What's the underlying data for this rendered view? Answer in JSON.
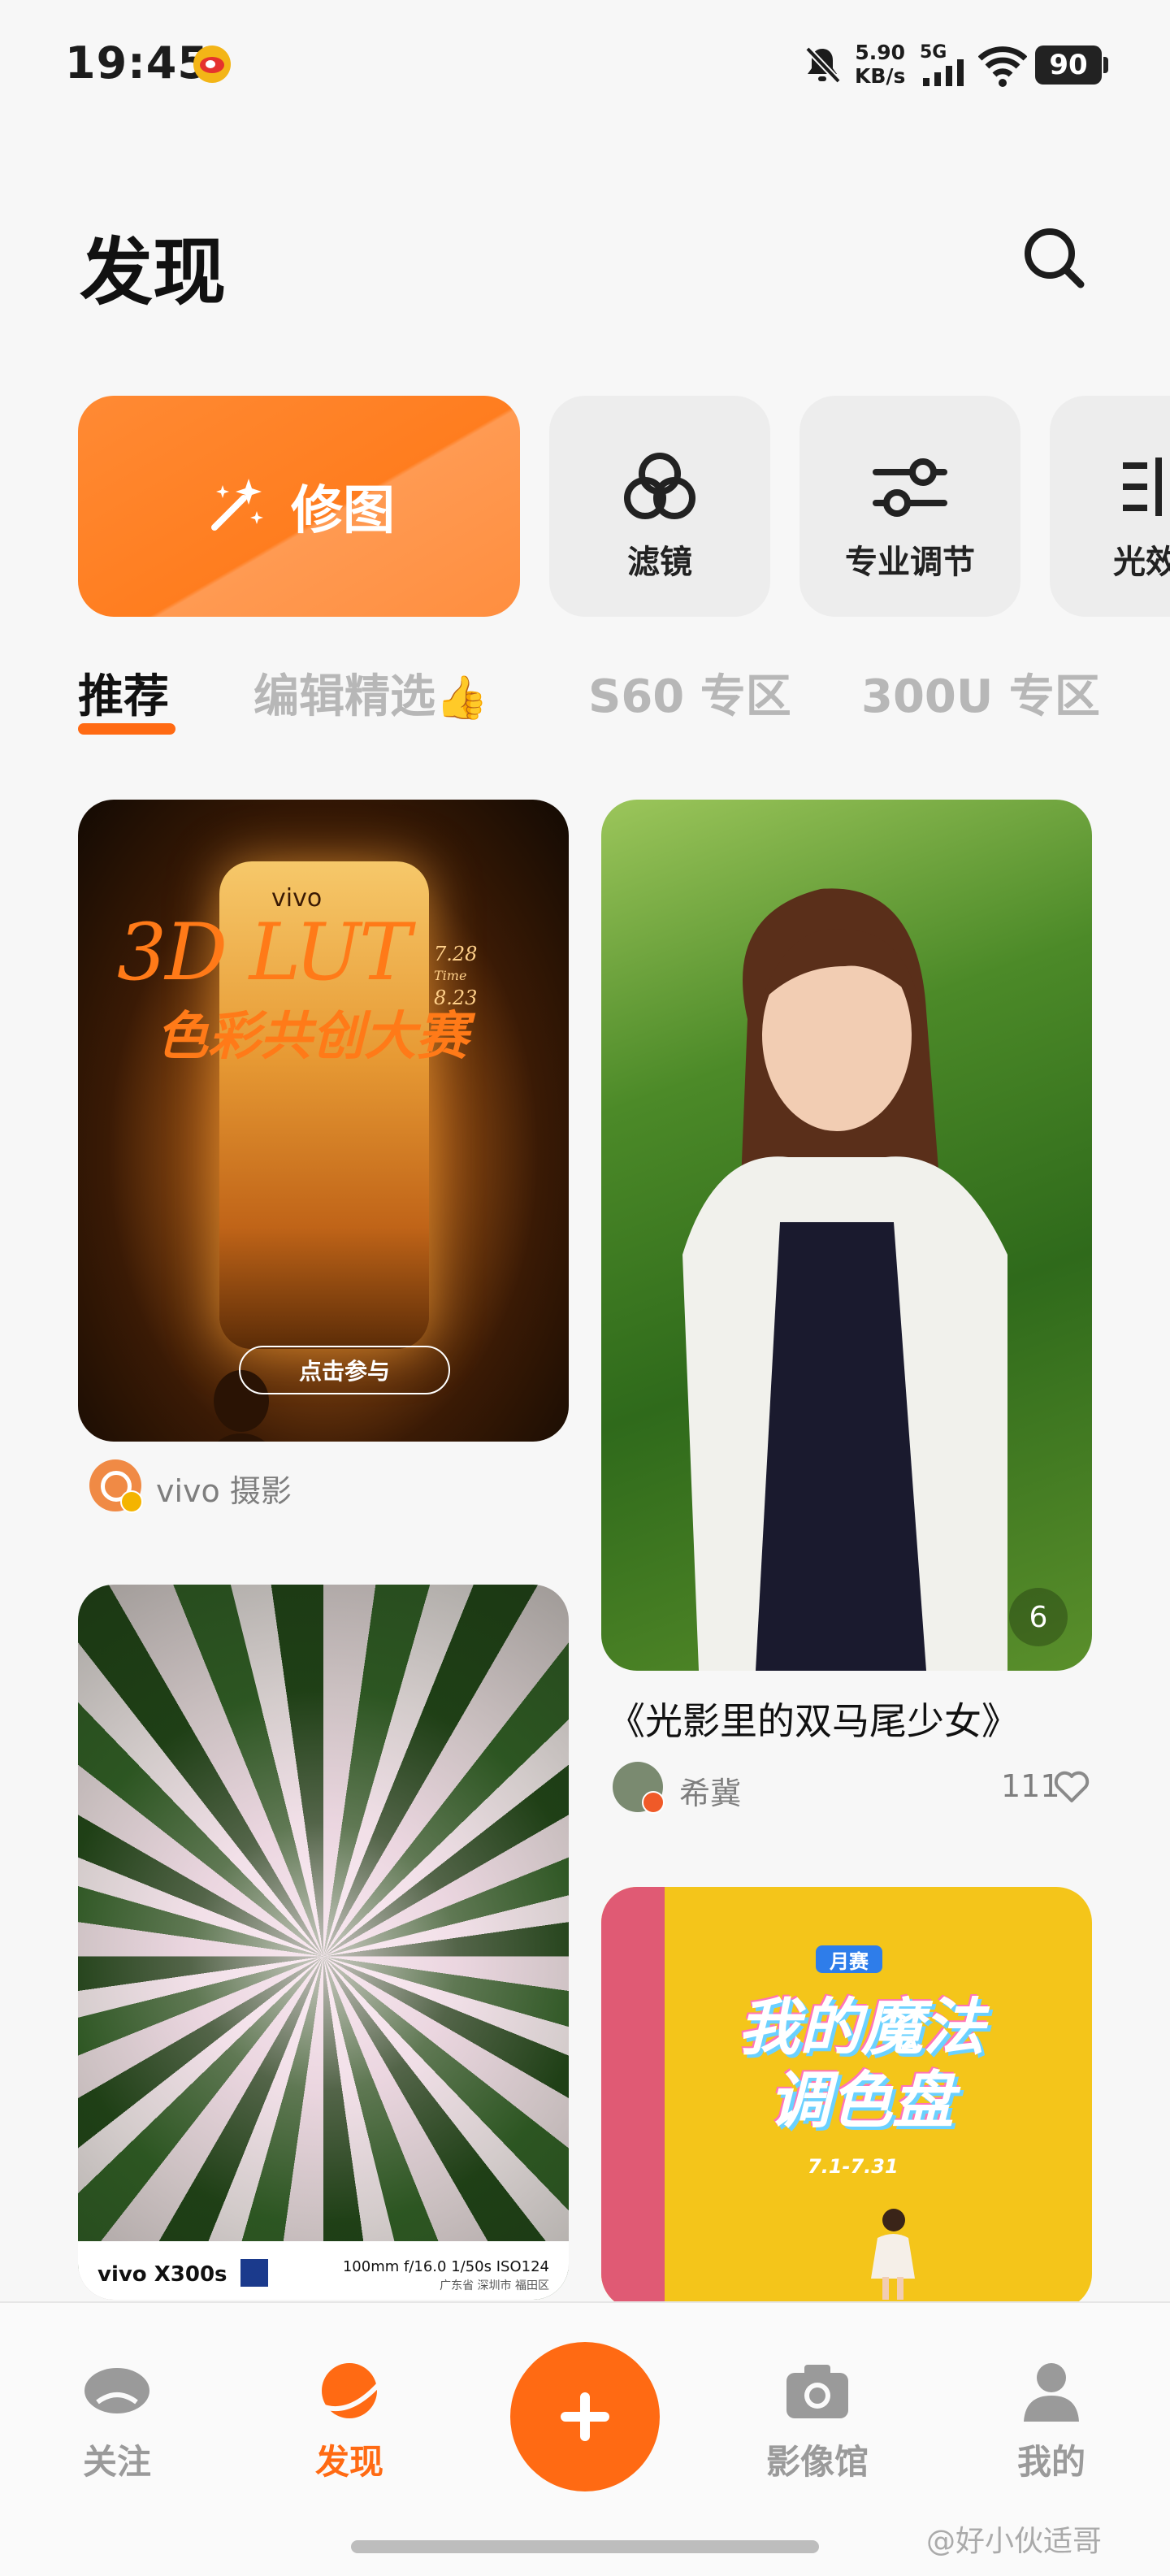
{
  "status_bar": {
    "time": "19:45",
    "net_speed_value": "5.90",
    "net_speed_unit": "KB/s",
    "network": "5G",
    "battery": "90",
    "icons": [
      "weibo-icon",
      "bell-off-icon",
      "signal-icon",
      "wifi-icon",
      "battery-icon"
    ]
  },
  "header": {
    "title": "发现",
    "search_icon": "search-icon"
  },
  "tools": [
    {
      "label": "修图",
      "icon": "magic-wand-icon"
    },
    {
      "label": "滤镜",
      "icon": "filter-circles-icon"
    },
    {
      "label": "专业调节",
      "icon": "sliders-icon"
    },
    {
      "label": "光效",
      "icon": "light-icon"
    }
  ],
  "category_tabs": [
    {
      "label": "推荐",
      "active": true
    },
    {
      "label": "编辑精选",
      "emoji": "👍",
      "active": false
    },
    {
      "label": "S60 专区",
      "active": false
    },
    {
      "label": "300U 专区",
      "active": false
    }
  ],
  "feed": {
    "left": [
      {
        "type": "banner",
        "brand": "vivo",
        "title": "3D LUT",
        "subtitle": "色彩共创大赛",
        "date_start": "7.28",
        "date_label": "Time",
        "date_end": "8.23",
        "cta": "点击参与",
        "author": "vivo 摄影"
      },
      {
        "type": "photo",
        "strip_brand": "vivo X300s",
        "strip_exif": "100mm  f/16.0  1/50s  ISO124",
        "strip_location": "广东省 深圳市 福田区"
      }
    ],
    "right": [
      {
        "type": "photo",
        "photo_count": "6",
        "title": "《光影里的双马尾少女》",
        "author": "希冀",
        "likes": "111"
      },
      {
        "type": "banner",
        "badge": "月赛",
        "title": "我的魔法调色盘",
        "date": "7.1-7.31"
      }
    ]
  },
  "bottom_nav": [
    {
      "label": "关注",
      "icon": "follow-eye-icon",
      "active": false
    },
    {
      "label": "发现",
      "icon": "discover-planet-icon",
      "active": true
    },
    {
      "label": "",
      "icon": "plus-icon",
      "active": false
    },
    {
      "label": "影像馆",
      "icon": "camera-icon",
      "active": false
    },
    {
      "label": "我的",
      "icon": "profile-icon",
      "active": false
    }
  ],
  "watermark": "@好小伙适哥",
  "colors": {
    "accent": "#ff6a13",
    "retouch_card": "#ff8a34",
    "tool_card_bg": "#ededed",
    "inactive_tab": "#b7b7b7"
  }
}
